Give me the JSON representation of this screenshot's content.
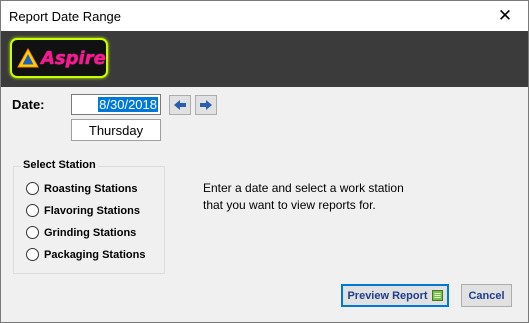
{
  "window": {
    "title": "Report Date Range",
    "close_glyph": "✕"
  },
  "logo": {
    "text": "Aspire",
    "icon": "warning-triangle-icon"
  },
  "date": {
    "label": "Date:",
    "value": "8/30/2018",
    "day": "Thursday"
  },
  "nav": {
    "prev_icon": "arrow-left-icon",
    "next_icon": "arrow-right-icon"
  },
  "station": {
    "title": "Select Station",
    "options": [
      "Roasting Stations",
      "Flavoring Stations",
      "Grinding Stations",
      "Packaging Stations"
    ]
  },
  "info": {
    "line1": "Enter a date and select a work station",
    "line2": "that you want to view reports for."
  },
  "buttons": {
    "preview": "Preview Report",
    "cancel": "Cancel"
  },
  "colors": {
    "banner": "#3b3b3b",
    "logo_border": "#c8ff00",
    "logo_text": "#ff1493",
    "button_text": "#1f3d8a",
    "selection": "#0078d7"
  }
}
